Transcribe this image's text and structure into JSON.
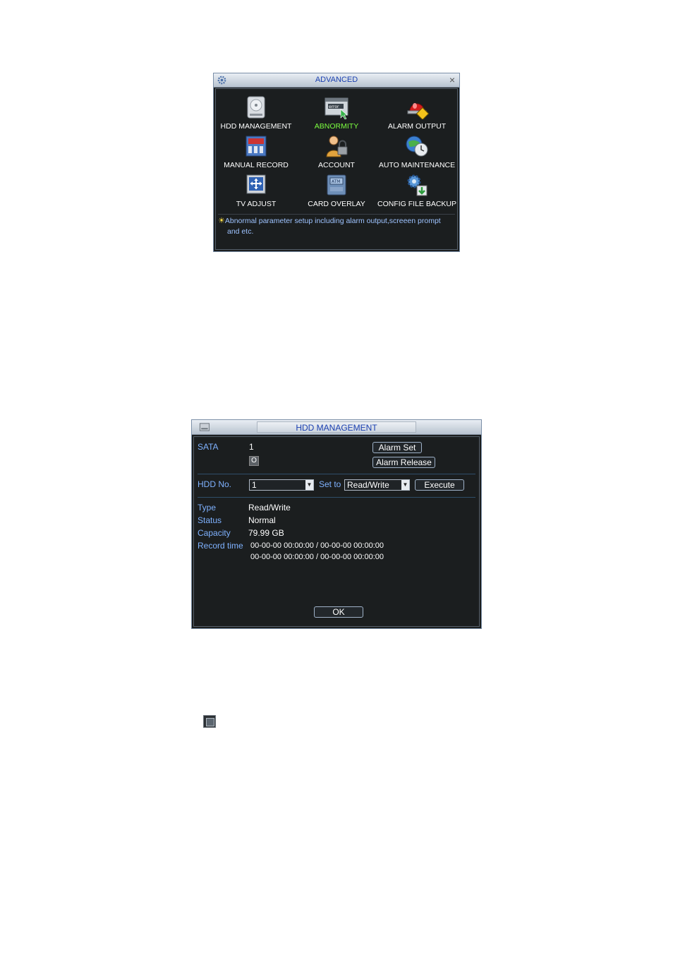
{
  "advanced": {
    "title": "ADVANCED",
    "close_glyph": "×",
    "tiles": [
      {
        "label": "HDD MANAGEMENT",
        "icon": "hdd-icon"
      },
      {
        "label": "ABNORMITY",
        "icon": "error-window-icon"
      },
      {
        "label": "ALARM OUTPUT",
        "icon": "alarm-siren-icon"
      },
      {
        "label": "MANUAL RECORD",
        "icon": "manual-record-icon"
      },
      {
        "label": "ACCOUNT",
        "icon": "user-lock-icon"
      },
      {
        "label": "AUTO MAINTENANCE",
        "icon": "auto-maintenance-icon"
      },
      {
        "label": "TV ADJUST",
        "icon": "tv-adjust-icon"
      },
      {
        "label": "CARD OVERLAY",
        "icon": "atm-card-icon"
      },
      {
        "label": "CONFIG FILE BACKUP",
        "icon": "config-backup-icon"
      }
    ],
    "active_tile": "ABNORMITY",
    "tip_line1": "Abnormal parameter setup including alarm output,screeen prompt",
    "tip_line2": "and etc."
  },
  "hdd": {
    "title": "HDD MANAGEMENT",
    "sata_label": "SATA",
    "sata_value": "1",
    "sata_check": "O",
    "alarm_set": "Alarm Set",
    "alarm_release": "Alarm Release",
    "hdd_no_label": "HDD No.",
    "hdd_no_value": "1",
    "set_to_label": "Set to",
    "set_to_value": "Read/Write",
    "execute": "Execute",
    "type_label": "Type",
    "type_value": "Read/Write",
    "status_label": "Status",
    "status_value": "Normal",
    "capacity_label": "Capacity",
    "capacity_value": "79.99 GB",
    "record_time_label": "Record time",
    "record_time_1": "00-00-00 00:00:00 / 00-00-00 00:00:00",
    "record_time_2": "00-00-00 00:00:00 / 00-00-00 00:00:00",
    "ok": "OK"
  },
  "colors": {
    "accent_green": "#7cff40",
    "label_blue": "#7fb2ff",
    "title_blue": "#1a3fb0"
  }
}
